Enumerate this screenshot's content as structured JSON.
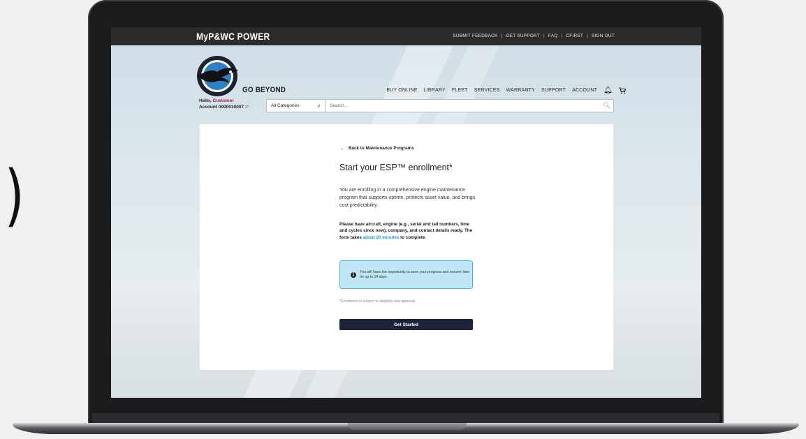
{
  "outer": {
    "paren": ")"
  },
  "topbar": {
    "brand": "MyP&WC POWER",
    "links": [
      "SUBMIT FEEDBACK",
      "GET SUPPORT",
      "FAQ",
      "CFIRST",
      "SIGN OUT"
    ]
  },
  "header": {
    "tagline": "GO BEYOND",
    "nav": [
      "BUY ONLINE",
      "LIBRARY",
      "FLEET",
      "SERVICES",
      "WARRANTY",
      "SUPPORT",
      "ACCOUNT"
    ],
    "icons": [
      "bell-icon",
      "cart-icon"
    ]
  },
  "account": {
    "hello": "Hello,",
    "customer": "Customer",
    "account_label": "Account 0000010007"
  },
  "search": {
    "category": "All Categories",
    "placeholder": "Search..."
  },
  "card": {
    "back_label": "Back to Maintenance Programs",
    "title": "Start your ESP™ enrollment*",
    "intro": "You are enrolling in a comprehensive engine maintenance program that supports uptime, protects asset value, and brings cost predictability.",
    "prep_before": "Please have aircraft, engine (e.g., serial and tail numbers, time and cycles since new), company, and contact details ready. The form takes ",
    "prep_highlight": "about 20 minutes",
    "prep_after": " to complete.",
    "note": "You will have the opportunity to save your progress and resume later for up to 14 days.",
    "disclaimer": "*Enrollment is subject to eligibility and approval.",
    "cta": "Get Started"
  },
  "colors": {
    "topbar": "#2b2b2b",
    "accent_link": "#1d9ad6",
    "note_bg": "#bfe7f5",
    "note_border": "#47b7e2",
    "button": "#1d2338",
    "customer_name": "#b01a4a"
  }
}
